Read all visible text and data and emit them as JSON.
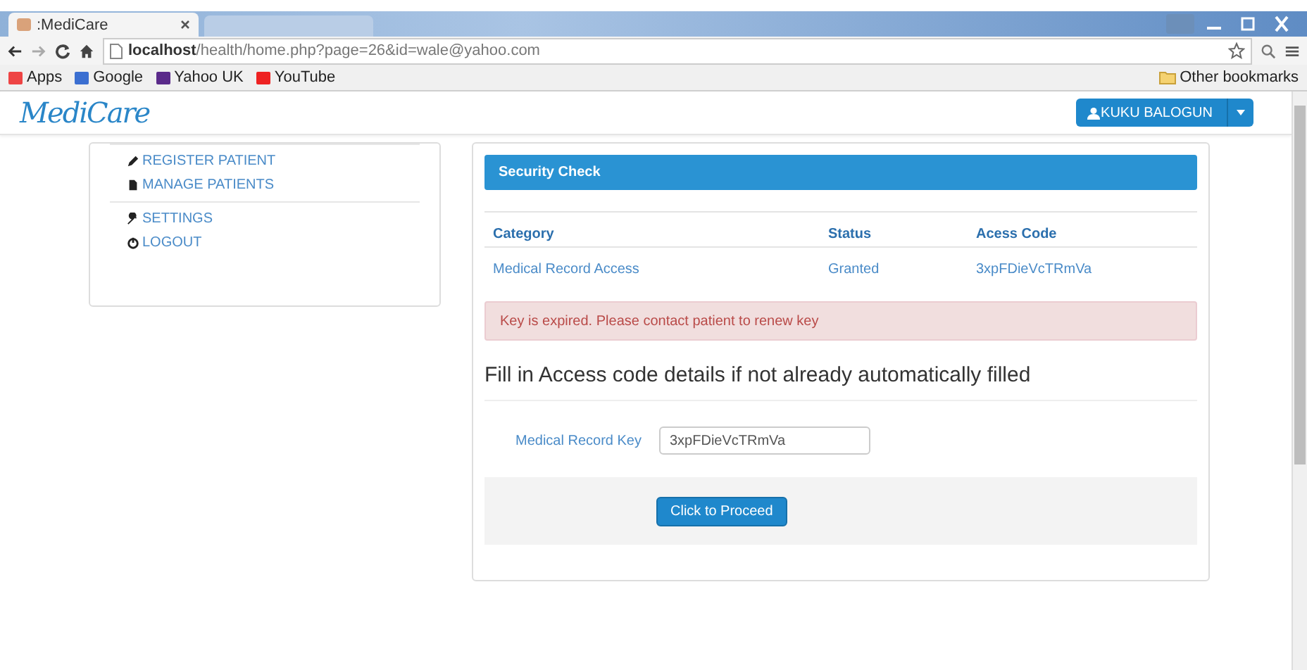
{
  "browser": {
    "tab_title": ":MediCare",
    "url_host": "localhost",
    "url_path": "/health/home.php?page=26&id=wale@yahoo.com",
    "bookmarks": [
      "Apps",
      "Google",
      "Yahoo UK",
      "YouTube"
    ],
    "other_bookmarks": "Other bookmarks"
  },
  "navbar": {
    "brand": "MediCare",
    "user": "KUKU BALOGUN"
  },
  "sidebar": {
    "groups": [
      [
        "REGISTER PATIENT",
        "MANAGE PATIENTS"
      ],
      [
        "SETTINGS",
        "LOGOUT"
      ]
    ]
  },
  "panel": {
    "title": "Security Check",
    "table": {
      "columns": [
        "Category",
        "Status",
        "Acess Code"
      ],
      "rows": [
        [
          "Medical Record Access",
          "Granted",
          "3xpFDieVcTRmVa"
        ]
      ]
    },
    "alert": "Key is expired. Please contact patient to renew key",
    "heading": "Fill in Access code details if not already automatically filled",
    "field": {
      "label": "Medical Record Key",
      "value": "3xpFDieVcTRmVa"
    },
    "button": "Click to Proceed"
  }
}
